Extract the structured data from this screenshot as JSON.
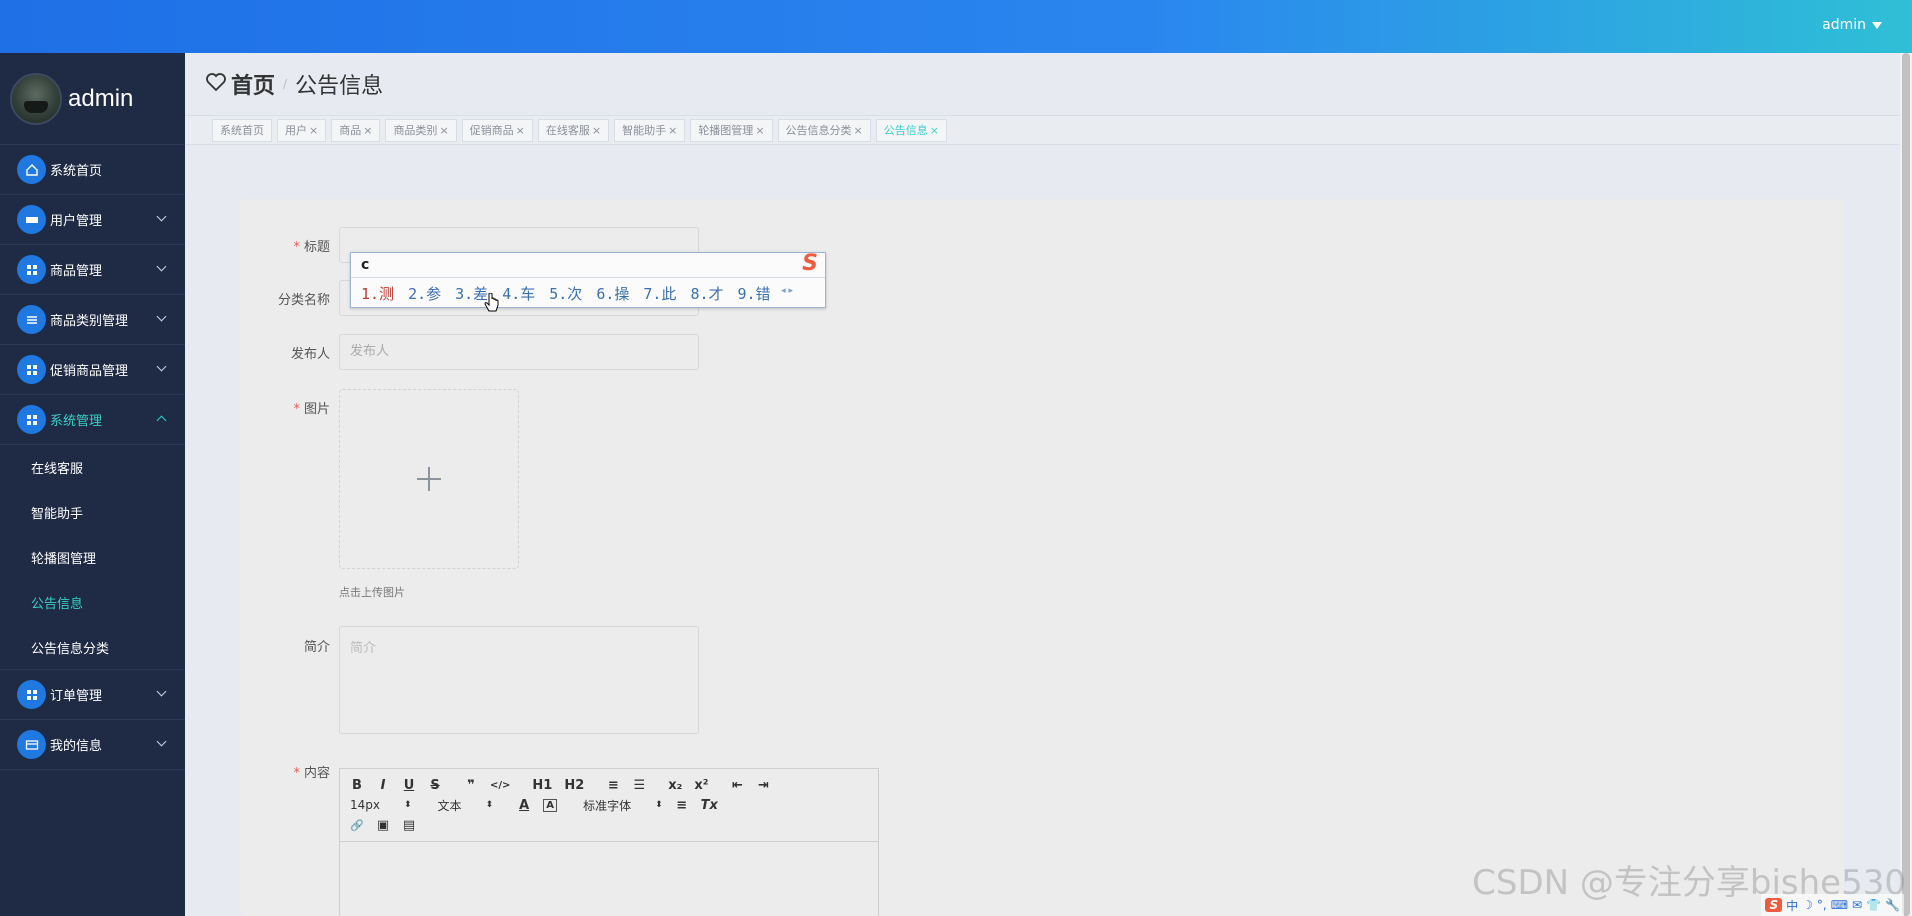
{
  "topbar": {
    "user": "admin"
  },
  "sidebar": {
    "user_name": "admin",
    "items": [
      {
        "label": "系统首页"
      },
      {
        "label": "用户管理"
      },
      {
        "label": "商品管理"
      },
      {
        "label": "商品类别管理"
      },
      {
        "label": "促销商品管理"
      },
      {
        "label": "系统管理"
      },
      {
        "label": "订单管理"
      },
      {
        "label": "我的信息"
      }
    ],
    "sub_items": [
      {
        "label": "在线客服"
      },
      {
        "label": "智能助手"
      },
      {
        "label": "轮播图管理"
      },
      {
        "label": "公告信息"
      },
      {
        "label": "公告信息分类"
      }
    ]
  },
  "breadcrumb": {
    "home": "首页",
    "sep": "/",
    "current": "公告信息"
  },
  "tags": [
    {
      "label": "系统首页",
      "close": ""
    },
    {
      "label": "用户",
      "close": "×"
    },
    {
      "label": "商品",
      "close": "×"
    },
    {
      "label": "商品类别",
      "close": "×"
    },
    {
      "label": "促销商品",
      "close": "×"
    },
    {
      "label": "在线客服",
      "close": "×"
    },
    {
      "label": "智能助手",
      "close": "×"
    },
    {
      "label": "轮播图管理",
      "close": "×"
    },
    {
      "label": "公告信息分类",
      "close": "×"
    },
    {
      "label": "公告信息",
      "close": "×"
    }
  ],
  "form": {
    "title_label": "标题",
    "category_label": "分类名称",
    "publisher_label": "发布人",
    "publisher_placeholder": "发布人",
    "image_label": "图片",
    "upload_hint": "点击上传图片",
    "intro_label": "简介",
    "intro_placeholder": "简介",
    "content_label": "内容",
    "required_mark": "*"
  },
  "editor": {
    "row1": [
      "B",
      "I",
      "U",
      "S",
      "❞",
      "</>",
      "H1",
      "H2",
      "≡",
      "☰",
      "x₂",
      "x²",
      "⇤",
      "⇥"
    ],
    "font_size": "14px",
    "text_style": "文本",
    "font_family": "标准字体",
    "row2_icons": [
      "A",
      "A",
      "≡",
      "Tx"
    ],
    "row3_icons": [
      "🔗",
      "▣",
      "▤"
    ]
  },
  "ime": {
    "typed": "c",
    "candidates": [
      "1.测",
      "2.参",
      "3.差",
      "4.车",
      "5.次",
      "6.操",
      "7.此",
      "8.才",
      "9.错"
    ],
    "logo": "S",
    "pager": "◂ ▸"
  },
  "watermark": "CSDN @专注分享bishe530",
  "tray": [
    "S",
    "中",
    "☽",
    "°,",
    "⌨",
    "✉",
    "👕",
    "🔧"
  ]
}
